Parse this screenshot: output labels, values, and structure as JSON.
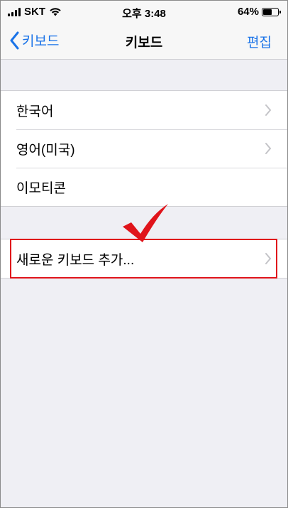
{
  "status": {
    "carrier": "SKT",
    "time": "오후 3:48",
    "battery": "64%",
    "battery_level": 0.64
  },
  "nav": {
    "back_label": "키보드",
    "title": "키보드",
    "edit_label": "편집"
  },
  "keyboards": [
    {
      "label": "한국어",
      "chevron": true
    },
    {
      "label": "영어(미국)",
      "chevron": true
    },
    {
      "label": "이모티콘",
      "chevron": false
    }
  ],
  "add_keyboard": {
    "label": "새로운 키보드 추가..."
  },
  "colors": {
    "accent": "#1a73e8",
    "highlight": "#e0141b",
    "background": "#efeff4"
  },
  "icons": {
    "back": "chevron-left-icon",
    "row": "chevron-right-icon",
    "annotation": "checkmark-icon",
    "wifi": "wifi-icon",
    "battery": "battery-icon"
  }
}
